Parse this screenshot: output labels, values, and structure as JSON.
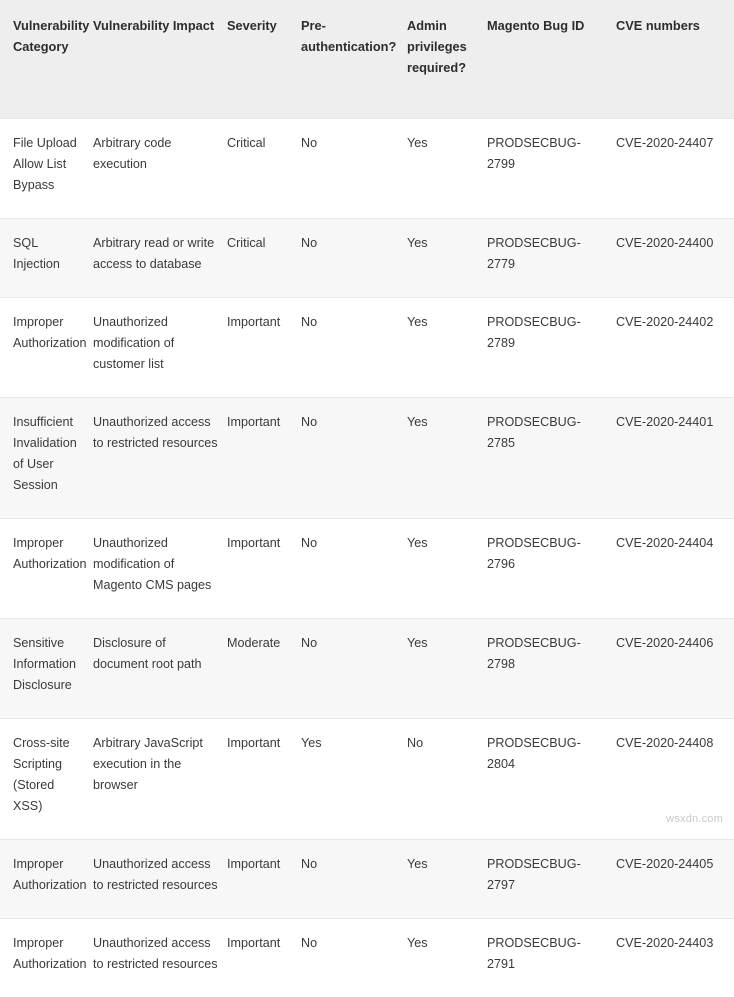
{
  "table": {
    "columns": [
      "Vulnerability Category",
      "Vulnerability Impact",
      "Severity",
      "Pre-authentication?",
      "Admin privileges required?",
      "Magento Bug ID",
      "CVE numbers"
    ],
    "rows": [
      {
        "category": "File Upload Allow List Bypass",
        "impact": "Arbitrary code execution",
        "severity": "Critical",
        "preauth": "No",
        "admin_privileges": "Yes",
        "bug_id": "PRODSECBUG-2799",
        "cve": "CVE-2020-24407"
      },
      {
        "category": "SQL Injection",
        "impact": "Arbitrary read or write access to database",
        "severity": "Critical",
        "preauth": "No",
        "admin_privileges": "Yes",
        "bug_id": "PRODSECBUG-2779",
        "cve": "CVE-2020-24400"
      },
      {
        "category": "Improper Authorization",
        "impact": "Unauthorized modification of customer list",
        "severity": "Important",
        "preauth": "No",
        "admin_privileges": "Yes",
        "bug_id": "PRODSECBUG-2789",
        "cve": "CVE-2020-24402"
      },
      {
        "category": "Insufficient Invalidation of User Session",
        "impact": "Unauthorized access to restricted resources",
        "severity": "Important",
        "preauth": "No",
        "admin_privileges": "Yes",
        "bug_id": "PRODSECBUG-2785",
        "cve": "CVE-2020-24401"
      },
      {
        "category": "Improper Authorization",
        "impact": "Unauthorized modification of Magento CMS pages",
        "severity": "Important",
        "preauth": "No",
        "admin_privileges": "Yes",
        "bug_id": "PRODSECBUG-2796",
        "cve": "CVE-2020-24404"
      },
      {
        "category": "Sensitive Information Disclosure",
        "impact": "Disclosure of document root path",
        "severity": "Moderate",
        "preauth": "No",
        "admin_privileges": "Yes",
        "bug_id": "PRODSECBUG-2798",
        "cve": "CVE-2020-24406"
      },
      {
        "category": "Cross-site Scripting (Stored XSS)",
        "impact": "Arbitrary JavaScript execution in the browser",
        "severity": "Important",
        "preauth": "Yes",
        "admin_privileges": "No",
        "bug_id": "PRODSECBUG-2804",
        "cve": "CVE-2020-24408"
      },
      {
        "category": "Improper Authorization",
        "impact": "Unauthorized access to restricted resources",
        "severity": "Important",
        "preauth": "No",
        "admin_privileges": "Yes",
        "bug_id": "PRODSECBUG-2797",
        "cve": "CVE-2020-24405"
      },
      {
        "category": "Improper Authorization",
        "impact": "Unauthorized access to restricted resources",
        "severity": "Important",
        "preauth": "No",
        "admin_privileges": "Yes",
        "bug_id": "PRODSECBUG-2791",
        "cve": "CVE-2020-24403"
      }
    ]
  },
  "watermark": {
    "text": "wsxdn.com"
  },
  "colors": {
    "header_background": "#eeeeee",
    "row_stripe": "#f7f7f7",
    "row_base": "#ffffff",
    "text": "#3a3a3a",
    "header_text": "#2d2d2d",
    "rule": "#e9e9e9",
    "watermark_text": "#c9c9c9"
  }
}
